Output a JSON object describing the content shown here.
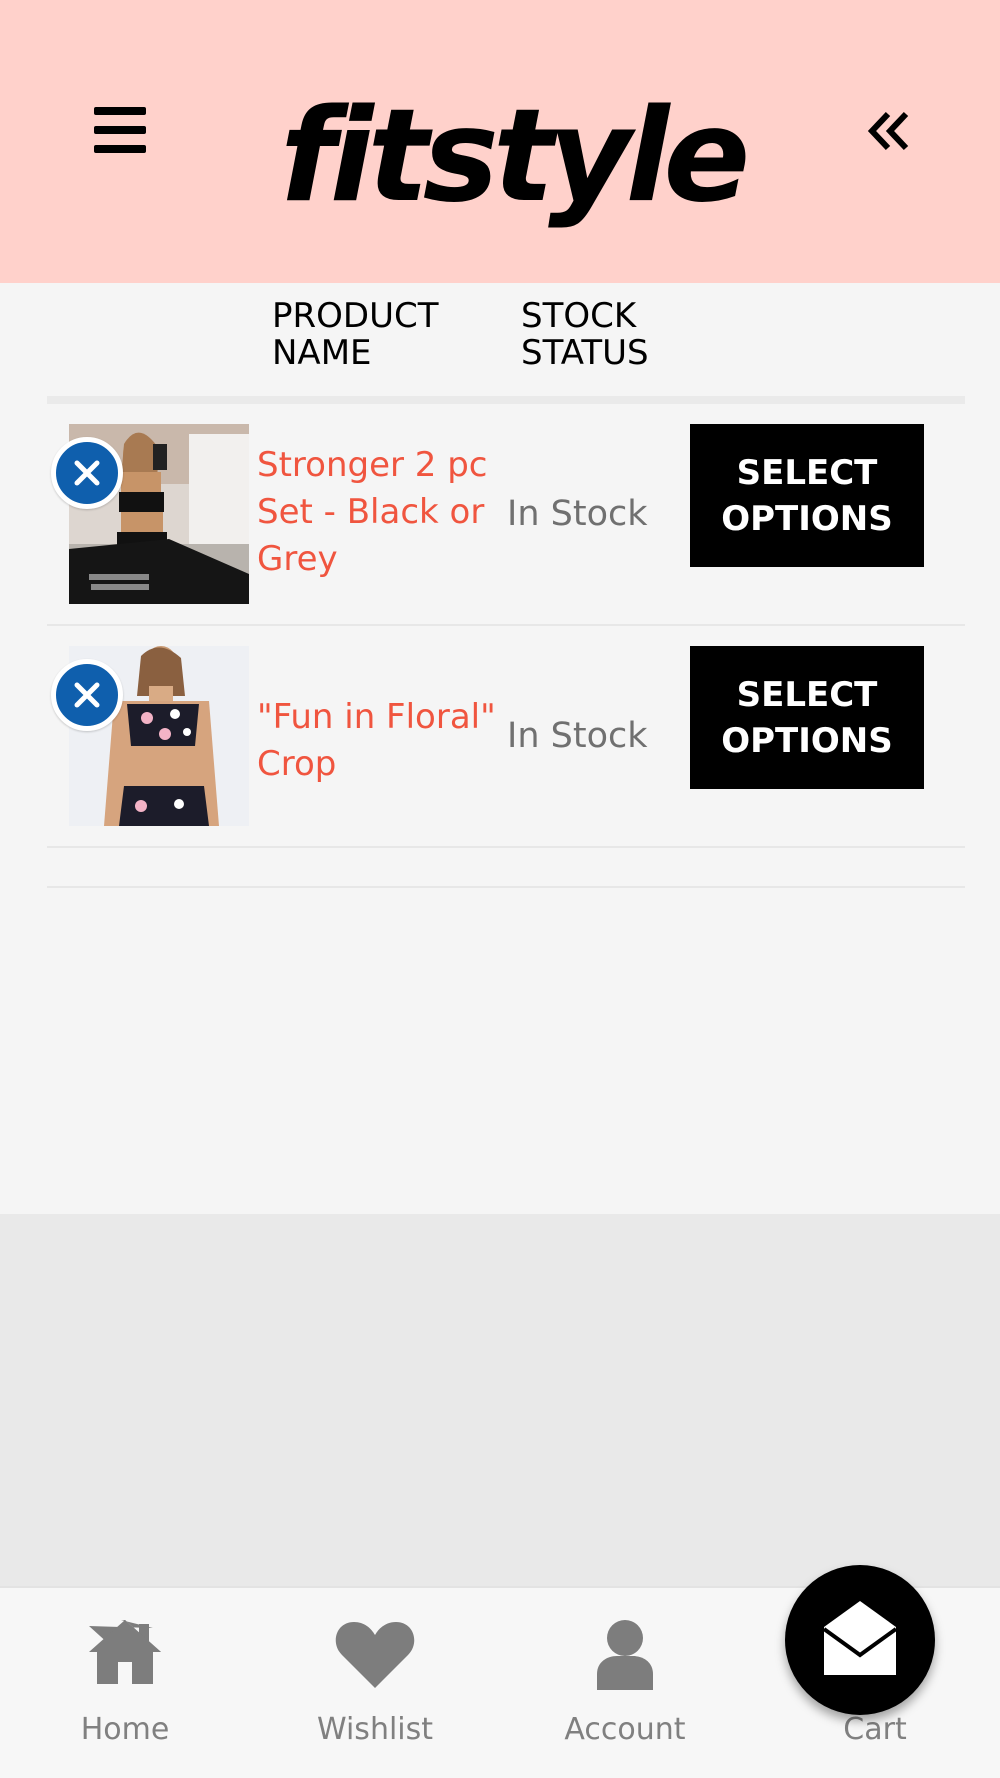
{
  "header": {
    "logo_text": "fitstyle",
    "menu_icon": "hamburger-menu-icon",
    "collapse_icon": "double-chevron-left-icon",
    "background_color": "#ffd1cb"
  },
  "table": {
    "columns": [
      "PRODUCT NAME",
      "STOCK STATUS"
    ],
    "rows": [
      {
        "name": "Stronger 2 pc Set - Black or Grey",
        "stock": "In Stock",
        "action": "SELECT OPTIONS",
        "remove_icon": "close-icon"
      },
      {
        "name": "\"Fun in Floral\" Crop",
        "stock": "In Stock",
        "action": "SELECT OPTIONS",
        "remove_icon": "close-icon"
      }
    ]
  },
  "colors": {
    "product_link": "#f0553f",
    "remove_button": "#0f5fad",
    "stock_text": "#707070",
    "action_button": "#000000"
  },
  "bottom_nav": {
    "items": [
      {
        "label": "Home",
        "icon": "home-icon"
      },
      {
        "label": "Wishlist",
        "icon": "heart-icon"
      },
      {
        "label": "Account",
        "icon": "user-icon"
      },
      {
        "label": "Cart",
        "icon": "envelope-open-icon"
      }
    ]
  }
}
